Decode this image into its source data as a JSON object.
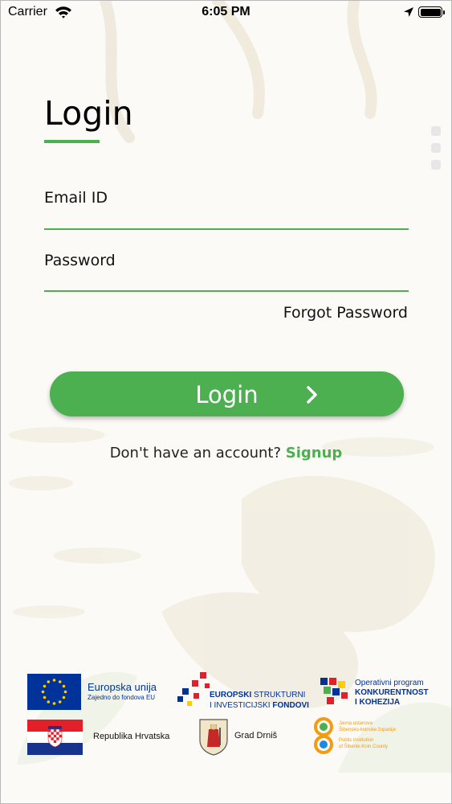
{
  "status_bar": {
    "carrier": "Carrier",
    "time": "6:05 PM"
  },
  "login": {
    "title": "Login",
    "email_label": "Email ID",
    "email_value": "",
    "password_label": "Password",
    "password_value": "",
    "forgot_password": "Forgot Password",
    "login_button": "Login",
    "no_account_text": "Don't have an account?",
    "signup_link": "Signup"
  },
  "partners": {
    "eu_line1": "Europska unija",
    "eu_line2": "Zajedno do fondova EU",
    "esif_line1_bold": "EUROPSKI",
    "esif_line1_rest": " STRUKTURNI",
    "esif_line2_rest": "I INVESTICIJSKI ",
    "esif_line2_bold": "FONDOVI",
    "op_line1": "Operativni program",
    "op_line2": "KONKURENTNOST",
    "op_line3": "I KOHEZIJA",
    "croatia": "Republika Hrvatska",
    "drnis": "Grad Drniš",
    "ju_line1": "Javna ustanova",
    "ju_line2": "Šibensko-kninske županije",
    "ju_line3": "Public institution",
    "ju_line4": "of Šibenik-Knin County"
  },
  "colors": {
    "accent": "#4caf50",
    "eu_blue": "#003399",
    "eu_star": "#ffcc00"
  }
}
